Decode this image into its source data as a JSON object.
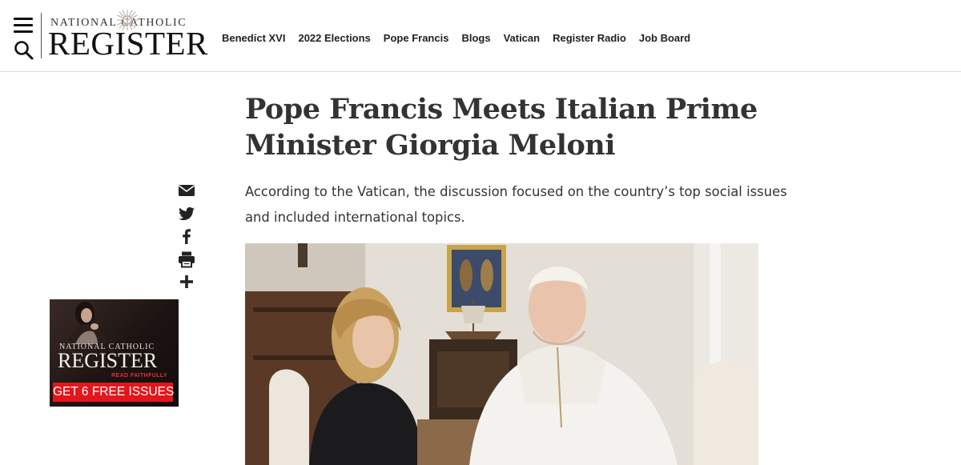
{
  "header": {
    "logo_top": "NATIONAL  CATHOLIC",
    "logo_main": "REGISTER",
    "nav": [
      {
        "label": "Benedict XVI"
      },
      {
        "label": "2022 Elections"
      },
      {
        "label": "Pope Francis"
      },
      {
        "label": "Blogs"
      },
      {
        "label": "Vatican"
      },
      {
        "label": "Register Radio"
      },
      {
        "label": "Job Board"
      }
    ]
  },
  "article": {
    "title": "Pope Francis Meets Italian Prime Minister Giorgia Meloni",
    "dek": "According to the Vatican, the discussion focused on the country’s top social issues and included international topics."
  },
  "share": {
    "icons": [
      "email-icon",
      "twitter-icon",
      "facebook-icon",
      "print-icon",
      "more-share-icon"
    ]
  },
  "ad": {
    "top": "NATIONAL CATHOLIC",
    "main": "REGISTER",
    "tagline": "READ FAITHFULLY",
    "cta": "GET 6 FREE ISSUES"
  },
  "colors": {
    "accent_red": "#e3161b",
    "text_dark": "#333333",
    "divider": "#d9d9d9"
  }
}
